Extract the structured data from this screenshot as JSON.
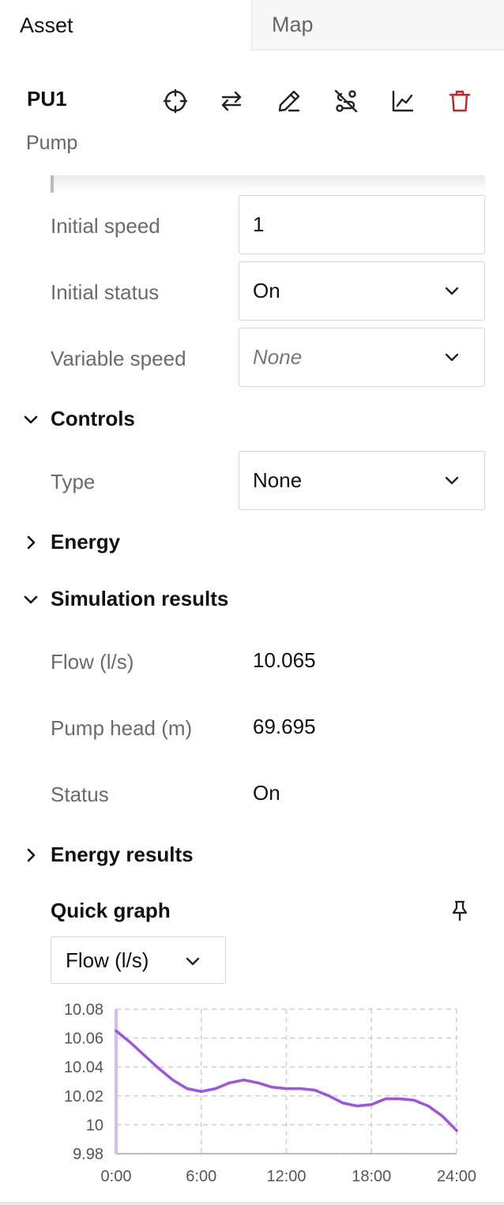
{
  "tabs": [
    {
      "label": "Asset",
      "active": true
    },
    {
      "label": "Map",
      "active": false
    }
  ],
  "asset": {
    "id": "PU1",
    "type": "Pump"
  },
  "toolbar": {
    "icons": [
      "crosshair-icon",
      "swap-icon",
      "edit-icon",
      "route-off-icon",
      "chart-icon",
      "trash-icon"
    ],
    "danger_color": "#d21f1f"
  },
  "properties": {
    "initial_speed": {
      "label": "Initial speed",
      "value": "1"
    },
    "initial_status": {
      "label": "Initial status",
      "value": "On"
    },
    "variable_speed": {
      "label": "Variable speed",
      "value": "None"
    }
  },
  "controls": {
    "title": "Controls",
    "expanded": true,
    "type": {
      "label": "Type",
      "value": "None"
    }
  },
  "energy": {
    "title": "Energy",
    "expanded": false
  },
  "simulation": {
    "title": "Simulation results",
    "expanded": true,
    "rows": [
      {
        "label": "Flow (l/s)",
        "value": "10.065"
      },
      {
        "label": "Pump head (m)",
        "value": "69.695"
      },
      {
        "label": "Status",
        "value": "On"
      }
    ]
  },
  "energy_results": {
    "title": "Energy results",
    "expanded": false
  },
  "quick_graph": {
    "title": "Quick graph",
    "selected": "Flow (l/s)"
  },
  "chart_data": {
    "type": "line",
    "title": "",
    "xlabel": "",
    "ylabel": "",
    "x_ticks": [
      "0:00",
      "6:00",
      "12:00",
      "18:00",
      "24:00"
    ],
    "y_ticks": [
      "10.08",
      "10.06",
      "10.04",
      "10.02",
      "10",
      "9.98"
    ],
    "xlim": [
      0,
      24
    ],
    "ylim": [
      9.98,
      10.08
    ],
    "grid": true,
    "series": [
      {
        "color": "#9d54e3",
        "x": [
          0,
          1,
          2,
          3,
          4,
          5,
          6,
          7,
          8,
          9,
          10,
          11,
          12,
          13,
          14,
          15,
          16,
          17,
          18,
          19,
          20,
          21,
          22,
          23,
          24
        ],
        "values": [
          10.065,
          10.057,
          10.048,
          10.039,
          10.031,
          10.025,
          10.023,
          10.025,
          10.029,
          10.031,
          10.029,
          10.026,
          10.025,
          10.025,
          10.024,
          10.02,
          10.015,
          10.013,
          10.014,
          10.018,
          10.018,
          10.017,
          10.013,
          10.006,
          9.996
        ]
      }
    ]
  }
}
